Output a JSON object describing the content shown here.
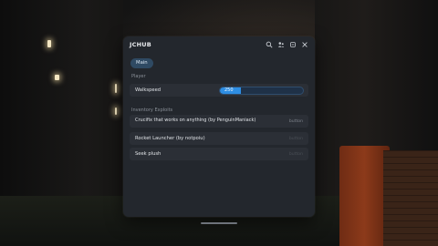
{
  "window": {
    "title": "JCHUB",
    "icons": [
      "search-icon",
      "players-icon",
      "minimize-icon",
      "close-icon"
    ]
  },
  "tabs": [
    {
      "label": "Main",
      "selected": true
    }
  ],
  "sections": {
    "player": {
      "heading": "Player"
    },
    "inventory": {
      "heading": "Inventory Exploits"
    }
  },
  "player": {
    "walkspeed": {
      "label": "Walkspeed",
      "value": "250",
      "fill_fraction": 0.25
    }
  },
  "inventory": {
    "items": [
      {
        "label": "Crucifix that works on anything (by PenguinManiack)",
        "key": "button"
      },
      {
        "label": "Rocket Launcher (by notpoiu)",
        "key": "button"
      },
      {
        "label": "Seek plush",
        "key": "button"
      }
    ]
  },
  "colors": {
    "accent": "#2e8ee3",
    "window_bg": "#23272d",
    "row_bg": "#2b2f36"
  }
}
